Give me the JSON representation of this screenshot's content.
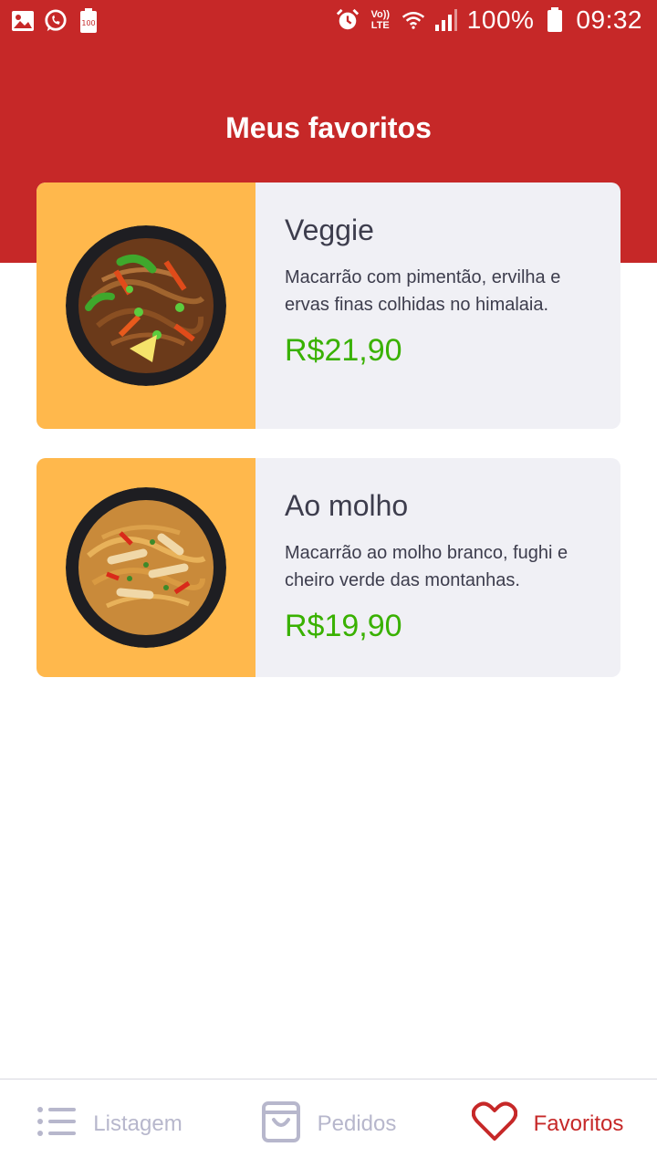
{
  "status_bar": {
    "battery": "100%",
    "time": "09:32",
    "battery_small_label": "100",
    "network_label_top": "Vo))",
    "network_label_bottom": "LTE",
    "icons": [
      "gallery-icon",
      "whatsapp-icon",
      "battery-saver-icon",
      "alarm-icon",
      "volte-icon",
      "wifi-icon",
      "signal-icon",
      "battery-icon"
    ]
  },
  "header": {
    "title": "Meus favoritos"
  },
  "favorites": [
    {
      "name": "Veggie",
      "description": "Macarrão com pimentão, ervilha e ervas finas colhidas no himalaia.",
      "price": "R$21,90"
    },
    {
      "name": "Ao molho",
      "description": "Macarrão ao molho branco, fughi e cheiro verde das montanhas.",
      "price": "R$19,90"
    }
  ],
  "bottom_nav": {
    "items": [
      {
        "label": "Listagem",
        "icon": "list-icon"
      },
      {
        "label": "Pedidos",
        "icon": "shopping-bag-icon"
      },
      {
        "label": "Favoritos",
        "icon": "heart-icon"
      }
    ],
    "active": "Favoritos"
  },
  "colors": {
    "primary": "#c62828",
    "thumb_bg": "#ffb84c",
    "card_bg": "#f0f0f5",
    "price": "#39b100",
    "nav_inactive": "#b7b7cc"
  }
}
